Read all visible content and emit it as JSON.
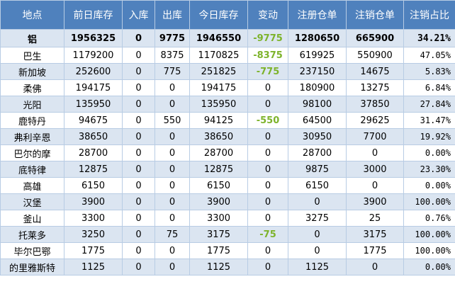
{
  "headers": [
    "地点",
    "前日库存",
    "入库",
    "出库",
    "今日库存",
    "变动",
    "注册仓单",
    "注销仓单",
    "注销占比"
  ],
  "colors": {
    "header_bg": "#4f81bd",
    "header_text": "#ffffff",
    "alt_row": "#dbe5f1",
    "negative_change": "#7db32b",
    "border": "#b8cce4"
  },
  "total": {
    "location": "铝",
    "prev": "1956325",
    "in": "0",
    "out": "9775",
    "today": "1946550",
    "change": "-9775",
    "reg": "1280650",
    "cancel": "665900",
    "ratio": "34.21%"
  },
  "rows": [
    {
      "location": "巴生",
      "prev": "1179200",
      "in": "0",
      "out": "8375",
      "today": "1170825",
      "change": "-8375",
      "reg": "619925",
      "cancel": "550900",
      "ratio": "47.05%"
    },
    {
      "location": "新加坡",
      "prev": "252600",
      "in": "0",
      "out": "775",
      "today": "251825",
      "change": "-775",
      "reg": "237150",
      "cancel": "14675",
      "ratio": "5.83%"
    },
    {
      "location": "柔佛",
      "prev": "194175",
      "in": "0",
      "out": "0",
      "today": "194175",
      "change": "0",
      "reg": "180900",
      "cancel": "13275",
      "ratio": "6.84%"
    },
    {
      "location": "光阳",
      "prev": "135950",
      "in": "0",
      "out": "0",
      "today": "135950",
      "change": "0",
      "reg": "98100",
      "cancel": "37850",
      "ratio": "27.84%"
    },
    {
      "location": "鹿特丹",
      "prev": "94675",
      "in": "0",
      "out": "550",
      "today": "94125",
      "change": "-550",
      "reg": "64500",
      "cancel": "29625",
      "ratio": "31.47%"
    },
    {
      "location": "弗利辛恩",
      "prev": "38650",
      "in": "0",
      "out": "0",
      "today": "38650",
      "change": "0",
      "reg": "30950",
      "cancel": "7700",
      "ratio": "19.92%"
    },
    {
      "location": "巴尔的摩",
      "prev": "28700",
      "in": "0",
      "out": "0",
      "today": "28700",
      "change": "0",
      "reg": "28700",
      "cancel": "0",
      "ratio": "0.00%"
    },
    {
      "location": "底特律",
      "prev": "12875",
      "in": "0",
      "out": "0",
      "today": "12875",
      "change": "0",
      "reg": "9875",
      "cancel": "3000",
      "ratio": "23.30%"
    },
    {
      "location": "高雄",
      "prev": "6150",
      "in": "0",
      "out": "0",
      "today": "6150",
      "change": "0",
      "reg": "6150",
      "cancel": "0",
      "ratio": "0.00%"
    },
    {
      "location": "汉堡",
      "prev": "3900",
      "in": "0",
      "out": "0",
      "today": "3900",
      "change": "0",
      "reg": "0",
      "cancel": "3900",
      "ratio": "100.00%"
    },
    {
      "location": "釜山",
      "prev": "3300",
      "in": "0",
      "out": "0",
      "today": "3300",
      "change": "0",
      "reg": "3275",
      "cancel": "25",
      "ratio": "0.76%"
    },
    {
      "location": "托莱多",
      "prev": "3250",
      "in": "0",
      "out": "75",
      "today": "3175",
      "change": "-75",
      "reg": "0",
      "cancel": "3175",
      "ratio": "100.00%"
    },
    {
      "location": "毕尔巴鄂",
      "prev": "1775",
      "in": "0",
      "out": "0",
      "today": "1775",
      "change": "0",
      "reg": "0",
      "cancel": "1775",
      "ratio": "100.00%"
    },
    {
      "location": "的里雅斯特",
      "prev": "1125",
      "in": "0",
      "out": "0",
      "today": "1125",
      "change": "0",
      "reg": "1125",
      "cancel": "0",
      "ratio": "0.00%"
    }
  ]
}
